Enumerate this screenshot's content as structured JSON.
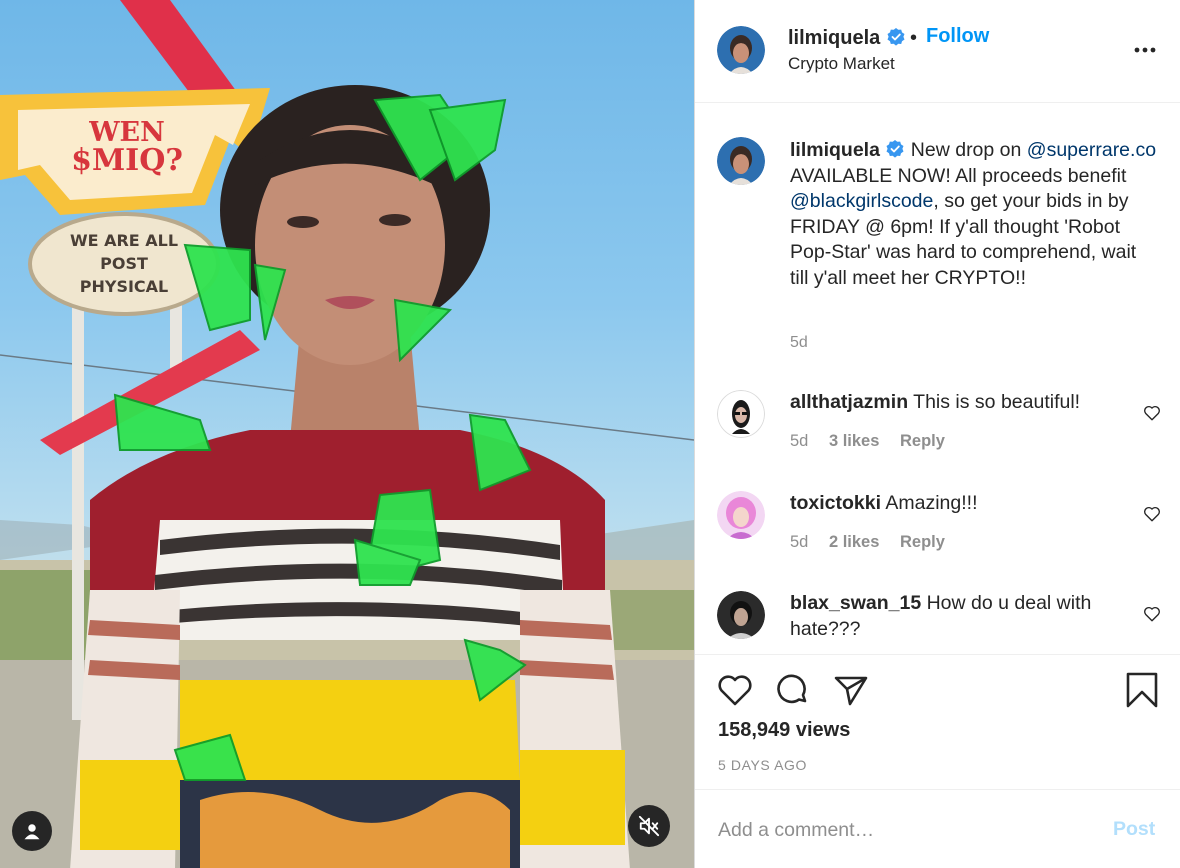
{
  "media": {
    "sign_top_line1": "WEN",
    "sign_top_line2": "$MIQ?",
    "sign_bottom_line1": "WE ARE ALL",
    "sign_bottom_line2": "POST",
    "sign_bottom_line3": "PHYSICAL",
    "user_icon": "user-icon",
    "mute_icon": "muted-speaker-icon"
  },
  "header": {
    "username": "lilmiquela",
    "separator": "•",
    "follow_label": "Follow",
    "location": "Crypto Market",
    "more_icon": "more-options-icon"
  },
  "caption": {
    "username": "lilmiquela",
    "text_1": " New drop on ",
    "mention_1": "@superrare.co",
    "text_2": " AVAILABLE NOW! All proceeds benefit ",
    "mention_2": "@blackgirlscode",
    "text_3": ", so get your bids in by FRIDAY @ 6pm! If y'all thought 'Robot Pop-Star' was hard to comprehend, wait till y'all meet her CRYPTO!!",
    "time": "5d"
  },
  "comments": [
    {
      "username": "allthatjazmin",
      "text": " This is so beautiful!",
      "time": "5d",
      "likes": "3 likes",
      "reply": "Reply"
    },
    {
      "username": "toxictokki",
      "text": " Amazing!!!",
      "time": "5d",
      "likes": "2 likes",
      "reply": "Reply"
    },
    {
      "username": "blax_swan_15",
      "text": " How do u deal with hate???",
      "time": "",
      "likes": "",
      "reply": ""
    }
  ],
  "actions": {
    "views": "158,949 views",
    "time_ago": "5 DAYS AGO"
  },
  "add_comment": {
    "placeholder": "Add a comment…",
    "post_label": "Post"
  },
  "colors": {
    "accent": "#0095f6",
    "mention": "#00376b",
    "secondary_text": "#8e8e8e",
    "post_disabled": "#b2dffc"
  }
}
